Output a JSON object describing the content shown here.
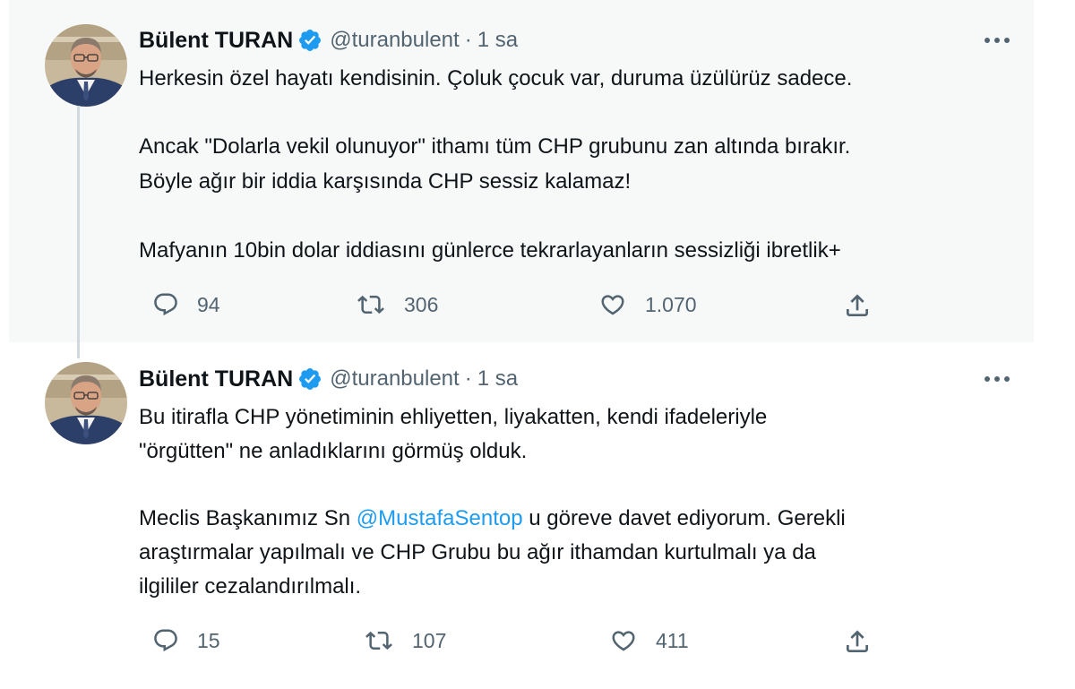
{
  "colors": {
    "accent": "#1d9bf0",
    "text_primary": "#0f1419",
    "text_secondary": "#536471",
    "hover_bg": "#f7f9f9",
    "thread_line": "#cfd9de"
  },
  "tweets": [
    {
      "author_name": "Bülent TURAN",
      "handle": "@turanbulent",
      "separator": "·",
      "time": "1 sa",
      "lines": [
        "Herkesin özel hayatı kendisinin. Çoluk çocuk var, duruma üzülürüz sadece.",
        "Ancak \"Dolarla vekil olunuyor\" ithamı tüm CHP grubunu zan altında bırakır.",
        "Böyle ağır bir iddia karşısında CHP sessiz kalamaz!",
        "Mafyanın 10bin dolar iddiasını günlerce tekrarlayanların sessizliği ibretlik+"
      ],
      "replies": "94",
      "retweets": "306",
      "likes": "1.070"
    },
    {
      "author_name": "Bülent TURAN",
      "handle": "@turanbulent",
      "separator": "·",
      "time": "1 sa",
      "lines": [
        "Bu itirafla CHP yönetiminin ehliyetten, liyakatten, kendi ifadeleriyle",
        "\"örgütten\" ne anladıklarını görmüş olduk.",
        "Meclis Başkanımız Sn ",
        "@MustafaSentop",
        " u göreve davet ediyorum. Gerekli",
        "araştırmalar yapılmalı ve CHP Grubu bu ağır ithamdan kurtulmalı ya da",
        "ilgililer cezalandırılmalı."
      ],
      "replies": "15",
      "retweets": "107",
      "likes": "411"
    }
  ],
  "icons": {
    "verified": "verified-badge-icon",
    "more": "more-icon",
    "reply": "reply-icon",
    "retweet": "retweet-icon",
    "like": "like-icon",
    "share": "share-icon"
  }
}
